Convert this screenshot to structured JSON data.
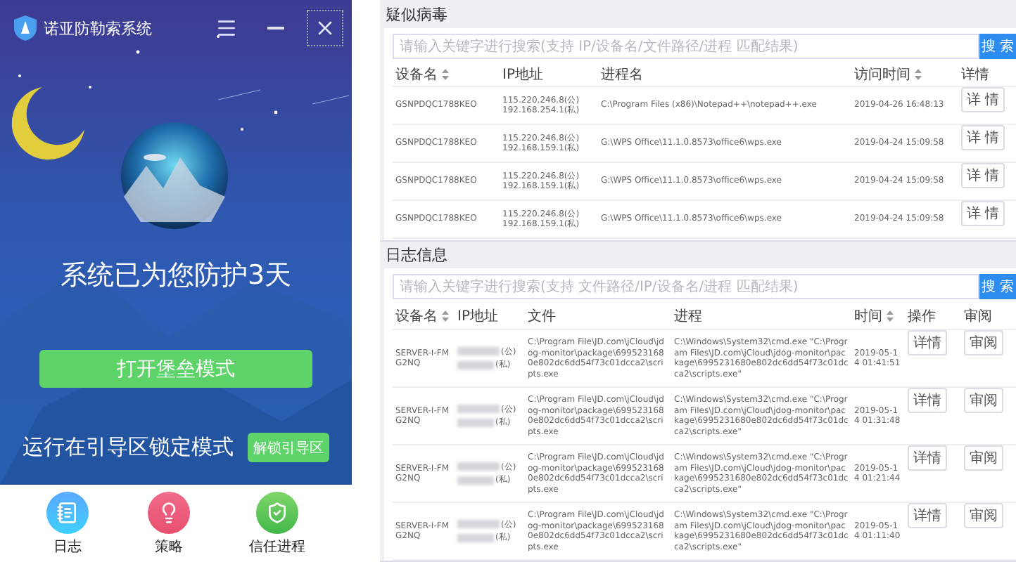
{
  "window": {
    "title": "诺亚防勒索系统"
  },
  "status": {
    "headline": "系统已为您防护3天",
    "fortress_button": "打开堡垒模式",
    "boot_mode": "运行在引导区锁定模式",
    "unlock_button": "解锁引导区"
  },
  "bottom_nav": [
    {
      "label": "日志",
      "kind": "log"
    },
    {
      "label": "策略",
      "kind": "strategy"
    },
    {
      "label": "信任进程",
      "kind": "trust"
    }
  ],
  "virus_panel": {
    "title": "疑似病毒",
    "search": {
      "placeholder": "请输入关键字进行搜索(支持 IP/设备名/文件路径/进程 匹配结果)",
      "button": "搜 索"
    },
    "columns": [
      {
        "label": "设备名",
        "sortable": true
      },
      {
        "label": "IP地址",
        "sortable": false
      },
      {
        "label": "进程名",
        "sortable": false
      },
      {
        "label": "访问时间",
        "sortable": true
      },
      {
        "label": "详情",
        "sortable": false
      }
    ],
    "rows": [
      {
        "device": "GSNPDQC1788KEO",
        "ip": [
          "115.220.246.8(公)",
          "192.168.254.1(私)"
        ],
        "process": "C:\\Program Files (x86)\\Notepad++\\notepad++.exe",
        "time": "2019-04-26 16:48:13",
        "action": "详 情"
      },
      {
        "device": "GSNPDQC1788KEO",
        "ip": [
          "115.220.246.8(公)",
          "192.168.159.1(私)"
        ],
        "process": "G:\\WPS Office\\11.1.0.8573\\office6\\wps.exe",
        "time": "2019-04-24 15:09:58",
        "action": "详 情"
      },
      {
        "device": "GSNPDQC1788KEO",
        "ip": [
          "115.220.246.8(公)",
          "192.168.159.1(私)"
        ],
        "process": "G:\\WPS Office\\11.1.0.8573\\office6\\wps.exe",
        "time": "2019-04-24 15:09:58",
        "action": "详 情"
      },
      {
        "device": "GSNPDQC1788KEO",
        "ip": [
          "115.220.246.8(公)",
          "192.168.159.1(私)"
        ],
        "process": "G:\\WPS Office\\11.1.0.8573\\office6\\wps.exe",
        "time": "2019-04-24 15:09:58",
        "action": "详 情"
      }
    ]
  },
  "log_panel": {
    "title": "日志信息",
    "search": {
      "placeholder": "请输入关键字进行搜索(支持 文件路径/IP/设备名/进程 匹配结果)",
      "button": "搜 索"
    },
    "columns": [
      {
        "label": "设备名",
        "sortable": true
      },
      {
        "label": "IP地址",
        "sortable": false
      },
      {
        "label": "文件",
        "sortable": false
      },
      {
        "label": "进程",
        "sortable": false
      },
      {
        "label": "时间",
        "sortable": true
      },
      {
        "label": "操作",
        "sortable": false
      },
      {
        "label": "审阅",
        "sortable": false
      }
    ],
    "rows": [
      {
        "device": "SERVER-I-FMG2NQ",
        "ip_tags": [
          "(公)",
          "(私)"
        ],
        "file": "C:\\Program File\\JD.com\\jCloud\\jdog-monitor\\package\\6995231680e802dc6dd54f73c01dcca2\\scripts.exe",
        "process": "C:\\Windows\\System32\\cmd.exe \"C:\\Program Files\\JD.com\\jCloud\\jdog-monitor\\package\\6995231680e802dc6dd54f73c01dcca2\\scripts.exe\"",
        "time": "2019-05-14 01:41:51",
        "actions": [
          "详情",
          "审阅"
        ]
      },
      {
        "device": "SERVER-I-FMG2NQ",
        "ip_tags": [
          "(公)",
          "(私)"
        ],
        "file": "C:\\Program File\\JD.com\\jCloud\\jdog-monitor\\package\\6995231680e802dc6dd54f73c01dcca2\\scripts.exe",
        "process": "C:\\Windows\\System32\\cmd.exe \"C:\\Program Files\\JD.com\\jCloud\\jdog-monitor\\package\\6995231680e802dc6dd54f73c01dcca2\\scripts.exe\"",
        "time": "2019-05-14 01:31:48",
        "actions": [
          "详情",
          "审阅"
        ]
      },
      {
        "device": "SERVER-I-FMG2NQ",
        "ip_tags": [
          "(公)",
          "(私)"
        ],
        "file": "C:\\Program File\\JD.com\\jCloud\\jdog-monitor\\package\\6995231680e802dc6dd54f73c01dcca2\\scripts.exe",
        "process": "C:\\Windows\\System32\\cmd.exe \"C:\\Program Files\\JD.com\\jCloud\\jdog-monitor\\package\\6995231680e802dc6dd54f73c01dcca2\\scripts.exe\"",
        "time": "2019-05-14 01:21:44",
        "actions": [
          "详情",
          "审阅"
        ]
      },
      {
        "device": "SERVER-I-FMG2NQ",
        "ip_tags": [
          "(公)",
          "(私)"
        ],
        "file": "C:\\Program File\\JD.com\\jCloud\\jdog-monitor\\package\\6995231680e802dc6dd54f73c01dcca2\\scripts.exe",
        "process": "C:\\Windows\\System32\\cmd.exe \"C:\\Program Files\\JD.com\\jCloud\\jdog-monitor\\package\\6995231680e802dc6dd54f73c01dcca2\\scripts.exe\"",
        "time": "2019-05-14 01:11:40",
        "actions": [
          "详情",
          "审阅"
        ]
      }
    ]
  }
}
